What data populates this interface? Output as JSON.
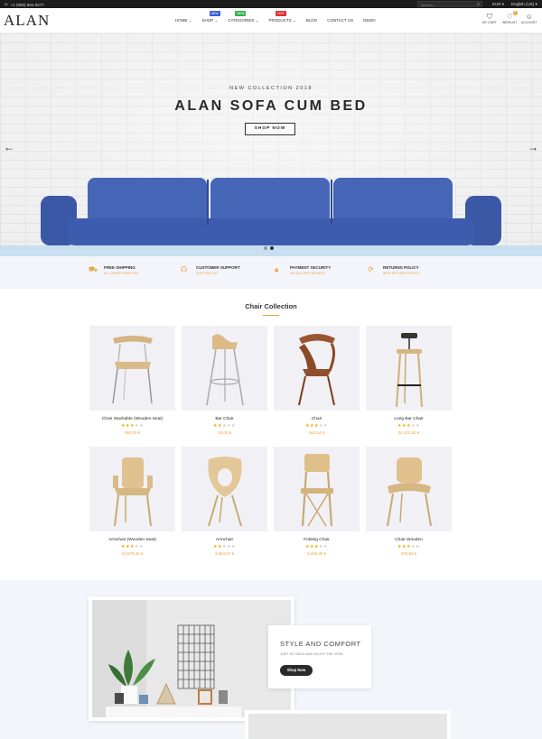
{
  "topbar": {
    "phone": "+1 (900) 691-0277",
    "search_placeholder": "Search...",
    "currency": "EUR",
    "language": "English (US)"
  },
  "header": {
    "logo": "ALAN",
    "nav": [
      {
        "label": "HOME",
        "caret": true,
        "badge": null,
        "badge_color": null
      },
      {
        "label": "SHOP",
        "caret": true,
        "badge": "NEW",
        "badge_color": "#3b5bdb"
      },
      {
        "label": "CATEGORIES",
        "caret": true,
        "badge": "NEW",
        "badge_color": "#37b24d"
      },
      {
        "label": "PRODUCTS",
        "caret": true,
        "badge": "HOT",
        "badge_color": "#e03131"
      },
      {
        "label": "BLOG",
        "caret": false,
        "badge": null,
        "badge_color": null
      },
      {
        "label": "CONTACT US",
        "caret": false,
        "badge": null,
        "badge_color": null
      },
      {
        "label": "DEMO",
        "caret": false,
        "badge": null,
        "badge_color": null
      }
    ],
    "cart_label": "MY CART",
    "wishlist_label": "WISHLIST",
    "wishlist_count": "0",
    "account_label": "ACCOUNT"
  },
  "hero": {
    "subtitle": "NEW COLLECTION 2018",
    "title": "ALAN SOFA CUM BED",
    "button": "SHOP NOW",
    "prev_icon": "arrow-left-icon",
    "next_icon": "arrow-right-icon",
    "slide_count": 2,
    "active_slide": 1
  },
  "features": [
    {
      "icon": "truck-icon",
      "title": "FREE SHIPPING",
      "desc": "ALL ORDER OVER $99"
    },
    {
      "icon": "headset-icon",
      "title": "CUSTOMER SUPPORT",
      "desc": "SUPPORT 24/7"
    },
    {
      "icon": "lock-icon",
      "title": "PAYMENT SECURITY",
      "desc": "100 SECURE PAYMENT"
    },
    {
      "icon": "refresh-icon",
      "title": "RETURNS POLICY",
      "desc": "BEST RETURNS POLICY"
    }
  ],
  "collection": {
    "title": "Chair Collection",
    "products": [
      {
        "name": "Chair Stackable (Wooden Seat)",
        "rating": 3,
        "price": "490.00 €"
      },
      {
        "name": "Bar Chair",
        "rating": 2,
        "price": "15.00 €"
      },
      {
        "name": "Chair",
        "rating": 3,
        "price": "183.14 €"
      },
      {
        "name": "Long Bar Chair",
        "rating": 3,
        "price": "24,102.50 €"
      },
      {
        "name": "Armchair (Wooden Seat)",
        "rating": 3,
        "price": "13,570.32 €"
      },
      {
        "name": "Armchair",
        "rating": 2,
        "price": "3,594.07 €"
      },
      {
        "name": "Folding Chair",
        "rating": 3,
        "price": "3,426.49 €"
      },
      {
        "name": "Chair Wooden",
        "rating": 3,
        "price": "378.63 €"
      }
    ]
  },
  "promo": {
    "heading": "STYLE AND COMFORT",
    "text": "JUST SIT BACK AND ENJOY THE VIEW",
    "button": "Shop Now"
  },
  "colors": {
    "accent": "#e8a33d",
    "dark": "#1c1c1c",
    "sofa": "#3f5fb0",
    "light_bg": "#f3f5fb"
  }
}
